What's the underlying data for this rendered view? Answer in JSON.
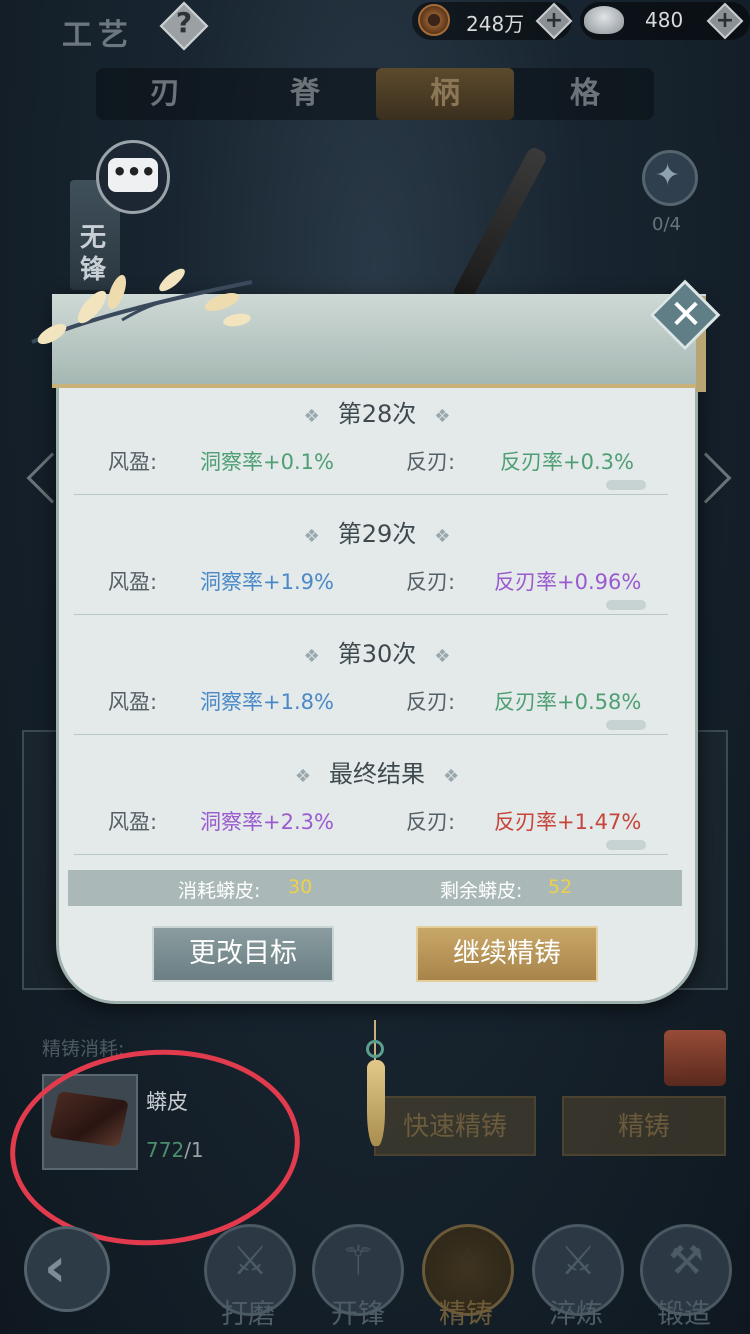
{
  "header": {
    "title": "工艺",
    "help": "?",
    "coins": "248万",
    "ingots": "480",
    "plus": "+"
  },
  "tabs": [
    {
      "label": "刃"
    },
    {
      "label": "脊"
    },
    {
      "label": "柄"
    },
    {
      "label": "格"
    }
  ],
  "side": {
    "banner": "无锋",
    "slot_count": "0/4",
    "chat_dots": "•••"
  },
  "modal": {
    "close": "✕",
    "rounds": [
      {
        "title": "第28次",
        "left_label": "风盈:",
        "left_value": "洞察率+0.1%",
        "right_label": "反刃:",
        "right_value": "反刃率+0.3%"
      },
      {
        "title": "第29次",
        "left_label": "风盈:",
        "left_value": "洞察率+1.9%",
        "right_label": "反刃:",
        "right_value": "反刃率+0.96%"
      },
      {
        "title": "第30次",
        "left_label": "风盈:",
        "left_value": "洞察率+1.8%",
        "right_label": "反刃:",
        "right_value": "反刃率+0.58%"
      },
      {
        "title": "最终结果",
        "left_label": "风盈:",
        "left_value": "洞察率+2.3%",
        "right_label": "反刃:",
        "right_value": "反刃率+1.47%"
      }
    ],
    "value_colors": [
      "#4f9e74",
      "#4a88c8",
      "#9a5ad0",
      "#c8443a"
    ],
    "cost": {
      "consumed_label": "消耗蟒皮:",
      "consumed_value": "30",
      "remaining_label": "剩余蟒皮:",
      "remaining_value": "52"
    },
    "btn_change": "更改目标",
    "btn_continue": "继续精铸"
  },
  "bottom": {
    "consume_label": "精铸消耗:",
    "item_name": "蟒皮",
    "item_have": "772",
    "item_need": "/1",
    "quick_cast": "快速精铸",
    "cast": "精铸"
  },
  "nav": [
    {
      "label": "打磨",
      "icon": "sword-icon"
    },
    {
      "label": "开锋",
      "icon": "blade-icon"
    },
    {
      "label": "精铸",
      "icon": "shuriken-icon"
    },
    {
      "label": "淬炼",
      "icon": "crossed-swords-icon"
    },
    {
      "label": "锻造",
      "icon": "anvil-hammer-icon"
    }
  ]
}
